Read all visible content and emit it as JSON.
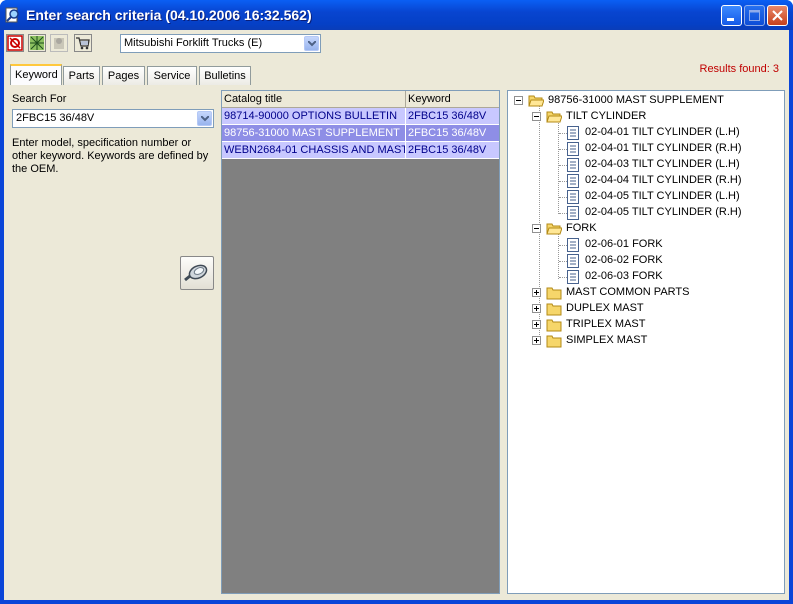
{
  "window": {
    "title": "Enter search criteria (04.10.2006 16:32.562)"
  },
  "toolbar": {
    "buttons": [
      {
        "icon": "red-circle-icon"
      },
      {
        "icon": "network-icon"
      },
      {
        "icon": "disabled-tool-icon"
      },
      {
        "icon": "shopping-cart-icon"
      }
    ],
    "vendor_select": "Mitsubishi Forklift Trucks (E)"
  },
  "tabs": [
    {
      "label": "Keyword",
      "active": true
    },
    {
      "label": "Parts"
    },
    {
      "label": "Pages"
    },
    {
      "label": "Service"
    },
    {
      "label": "Bulletins"
    }
  ],
  "results": {
    "text": "Results found: 3"
  },
  "search": {
    "label": "Search For",
    "value": "2FBC15 36/48V",
    "hint": "Enter model, specification number or other keyword.  Keywords are defined by the OEM."
  },
  "grid": {
    "columns": [
      "Catalog title",
      "Keyword"
    ],
    "rows": [
      {
        "title": "98714-90000 OPTIONS BULLETIN",
        "keyword": "2FBC15 36/48V"
      },
      {
        "title": "98756-31000 MAST SUPPLEMENT",
        "keyword": "2FBC15 36/48V",
        "selected": true
      },
      {
        "title": "WEBN2684-01 CHASSIS AND MAST",
        "keyword": "2FBC15 36/48V"
      }
    ]
  },
  "tree": {
    "root": "98756-31000 MAST SUPPLEMENT",
    "nodes": [
      {
        "label": "TILT CYLINDER"
      },
      {
        "label": "02-04-01 TILT CYLINDER (L.H)"
      },
      {
        "label": "02-04-01 TILT CYLINDER (R.H)"
      },
      {
        "label": "02-04-03 TILT CYLINDER (L.H)"
      },
      {
        "label": "02-04-04 TILT CYLINDER (R.H)"
      },
      {
        "label": "02-04-05 TILT CYLINDER (L.H)"
      },
      {
        "label": "02-04-05 TILT CYLINDER (R.H)"
      },
      {
        "label": "FORK"
      },
      {
        "label": "02-06-01 FORK"
      },
      {
        "label": "02-06-02 FORK"
      },
      {
        "label": "02-06-03 FORK"
      },
      {
        "label": "MAST COMMON PARTS"
      },
      {
        "label": "DUPLEX MAST"
      },
      {
        "label": "TRIPLEX MAST"
      },
      {
        "label": "SIMPLEX MAST"
      }
    ]
  }
}
